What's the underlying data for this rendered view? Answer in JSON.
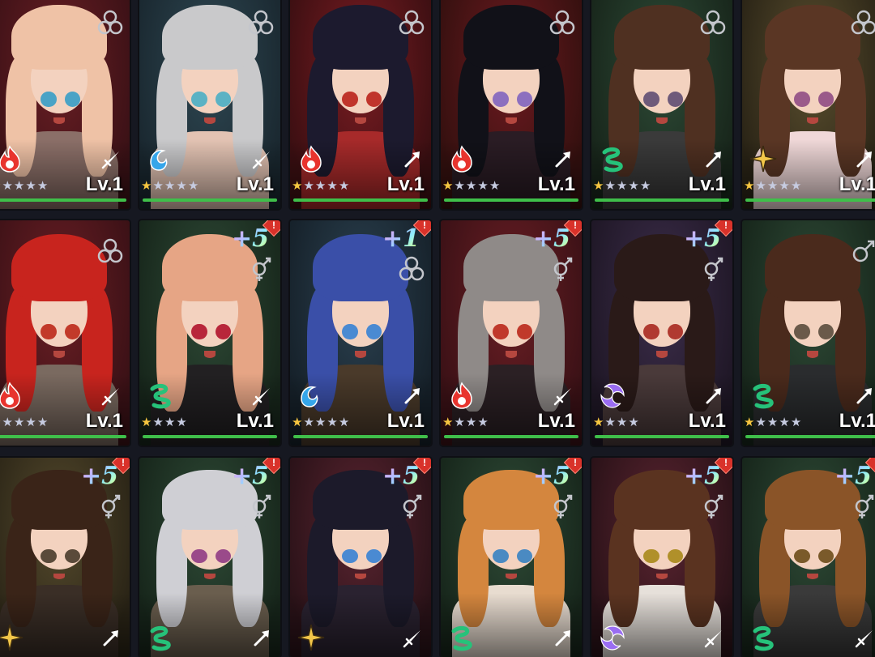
{
  "screen": "character-roster",
  "colors": {
    "fire": "#e8342e",
    "water": "#36a6ea",
    "wind": "#26c27a",
    "dark": "#9a6df2",
    "light": "#f2c649",
    "exp_bar": "#3fbf4a"
  },
  "characters": [
    {
      "element": "fire",
      "weapon": "sword",
      "stars": 1,
      "max_stars": 5,
      "level": "Lv.1",
      "gender": "female-icon",
      "promo": "",
      "alert": false,
      "bg": [
        "#6a1e24",
        "#3b1116"
      ],
      "hair": "#efc2a6",
      "eye": "#4aa3c6",
      "outfit": "#8b6f68"
    },
    {
      "element": "water",
      "weapon": "sword",
      "stars": 1,
      "max_stars": 5,
      "level": "Lv.1",
      "gender": "female-icon",
      "promo": "",
      "alert": false,
      "bg": [
        "#2e4752",
        "#1a2830"
      ],
      "hair": "#c9c9cb",
      "eye": "#5bb2c4",
      "outfit": "#e3c3b3"
    },
    {
      "element": "fire",
      "weapon": "axe",
      "stars": 1,
      "max_stars": 5,
      "level": "Lv.1",
      "gender": "female-icon",
      "promo": "",
      "alert": false,
      "bg": [
        "#7a1c22",
        "#3c0f12"
      ],
      "hair": "#1c1a2e",
      "eye": "#c0352c",
      "outfit": "#a72a2a"
    },
    {
      "element": "fire",
      "weapon": "axe",
      "stars": 1,
      "max_stars": 5,
      "level": "Lv.1",
      "gender": "female-icon",
      "promo": "",
      "alert": false,
      "bg": [
        "#6d1a20",
        "#35100f"
      ],
      "hair": "#111118",
      "eye": "#8c6fbf",
      "outfit": "#2a1c24"
    },
    {
      "element": "wind",
      "weapon": "axe",
      "stars": 1,
      "max_stars": 5,
      "level": "Lv.1",
      "gender": "female-icon",
      "promo": "",
      "alert": false,
      "bg": [
        "#2d4a36",
        "#18261b"
      ],
      "hair": "#4f3021",
      "eye": "#6e5a7a",
      "outfit": "#3a3a3a"
    },
    {
      "element": "light",
      "weapon": "axe",
      "stars": 1,
      "max_stars": 5,
      "level": "Lv.1",
      "gender": "female-icon",
      "promo": "",
      "alert": false,
      "bg": [
        "#5a4e2e",
        "#2a2416"
      ],
      "hair": "#5a3624",
      "eye": "#9a5a8a",
      "outfit": "#f0d8d8"
    },
    {
      "element": "fire",
      "weapon": "sword",
      "stars": 1,
      "max_stars": 5,
      "level": "Lv.1",
      "gender": "female-icon",
      "promo": "",
      "alert": false,
      "bg": [
        "#6a1e24",
        "#3b1116"
      ],
      "hair": "#c8241e",
      "eye": "#c23a2a",
      "outfit": "#7a6a60"
    },
    {
      "element": "wind",
      "weapon": "sword",
      "stars": 1,
      "max_stars": 4,
      "level": "Lv.1",
      "gender": "male-female-icon",
      "promo": "+5",
      "alert": true,
      "bg": [
        "#2e4a36",
        "#17261b"
      ],
      "hair": "#e6a585",
      "eye": "#b8263a",
      "outfit": "#222022"
    },
    {
      "element": "water",
      "weapon": "axe",
      "stars": 1,
      "max_stars": 5,
      "level": "Lv.1",
      "gender": "female-icon",
      "promo": "+1",
      "alert": true,
      "bg": [
        "#2b4150",
        "#16212a"
      ],
      "hair": "#3a4fa8",
      "eye": "#4a8ad2",
      "outfit": "#4a3a2a"
    },
    {
      "element": "fire",
      "weapon": "sword",
      "stars": 1,
      "max_stars": 4,
      "level": "Lv.1",
      "gender": "male-female-icon",
      "promo": "+5",
      "alert": true,
      "bg": [
        "#6a1e24",
        "#3b1116"
      ],
      "hair": "#8f8a88",
      "eye": "#c0392b",
      "outfit": "#2b2024"
    },
    {
      "element": "dark",
      "weapon": "axe",
      "stars": 1,
      "max_stars": 4,
      "level": "Lv.1",
      "gender": "male-female-icon",
      "promo": "+5",
      "alert": true,
      "bg": [
        "#3c2d4a",
        "#1f1726"
      ],
      "hair": "#2a1a18",
      "eye": "#b03a30",
      "outfit": "#4a3a3a"
    },
    {
      "element": "wind",
      "weapon": "axe",
      "stars": 1,
      "max_stars": 5,
      "level": "Lv.1",
      "gender": "male-icon",
      "promo": "",
      "alert": false,
      "bg": [
        "#2e4a36",
        "#17261b"
      ],
      "hair": "#4a2a1c",
      "eye": "#6a5a4a",
      "outfit": "#2a2c2e"
    },
    {
      "element": "light",
      "weapon": "axe",
      "stars": 0,
      "max_stars": 0,
      "level": "",
      "gender": "male-female-icon",
      "promo": "+5",
      "alert": true,
      "bg": [
        "#54492c",
        "#2a2416"
      ],
      "hair": "#3a2418",
      "eye": "#5a4a3a",
      "outfit": "#3a2e26"
    },
    {
      "element": "wind",
      "weapon": "axe",
      "stars": 0,
      "max_stars": 0,
      "level": "",
      "gender": "male-female-icon",
      "promo": "+5",
      "alert": true,
      "bg": [
        "#2e4a36",
        "#17261b"
      ],
      "hair": "#cfcfd4",
      "eye": "#9a4a8a",
      "outfit": "#6a5e4e"
    },
    {
      "element": "light",
      "weapon": "sword",
      "stars": 0,
      "max_stars": 0,
      "level": "",
      "gender": "male-female-icon",
      "promo": "+5",
      "alert": true,
      "bg": [
        "#5a2430",
        "#2a1218"
      ],
      "hair": "#1c1a2a",
      "eye": "#4a8ad2",
      "outfit": "#2a2230"
    },
    {
      "element": "wind",
      "weapon": "axe",
      "stars": 0,
      "max_stars": 0,
      "level": "",
      "gender": "male-female-icon",
      "promo": "+5",
      "alert": true,
      "bg": [
        "#2e4a36",
        "#17261b"
      ],
      "hair": "#d4863e",
      "eye": "#4a8ac2",
      "outfit": "#e8dcd0"
    },
    {
      "element": "dark",
      "weapon": "sword",
      "stars": 0,
      "max_stars": 0,
      "level": "",
      "gender": "male-female-icon",
      "promo": "+5",
      "alert": true,
      "bg": [
        "#5a2430",
        "#2a1218"
      ],
      "hair": "#5a3320",
      "eye": "#b0902a",
      "outfit": "#e6e0da"
    },
    {
      "element": "wind",
      "weapon": "sword",
      "stars": 0,
      "max_stars": 0,
      "level": "",
      "gender": "male-female-icon",
      "promo": "+5",
      "alert": true,
      "bg": [
        "#2e4a36",
        "#17261b"
      ],
      "hair": "#8a5428",
      "eye": "#7a5a2a",
      "outfit": "#3a3a3a"
    }
  ]
}
